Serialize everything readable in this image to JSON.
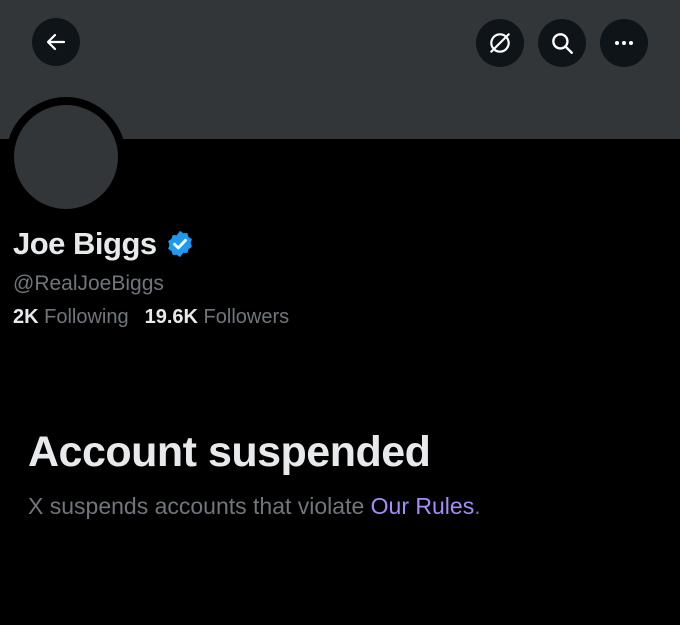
{
  "header": {
    "back_icon": "arrow-left-icon",
    "translate_icon": "translate-off-icon",
    "search_icon": "search-icon",
    "more_icon": "more-dots-icon"
  },
  "profile": {
    "display_name": "Joe Biggs",
    "verified_icon": "verified-badge-icon",
    "handle": "@RealJoeBiggs",
    "following_count": "2K",
    "following_label": "Following",
    "followers_count": "19.6K",
    "followers_label": "Followers"
  },
  "suspension": {
    "title": "Account suspended",
    "message_prefix": "X suspends accounts that violate ",
    "rules_link": "Our Rules",
    "message_suffix": "."
  },
  "colors": {
    "background": "#000000",
    "banner": "#333639",
    "button_bg": "#0f1419",
    "primary_text": "#e7e9ea",
    "secondary_text": "#71767b",
    "link": "#a78bfa",
    "verified": "#1d9bf0"
  }
}
